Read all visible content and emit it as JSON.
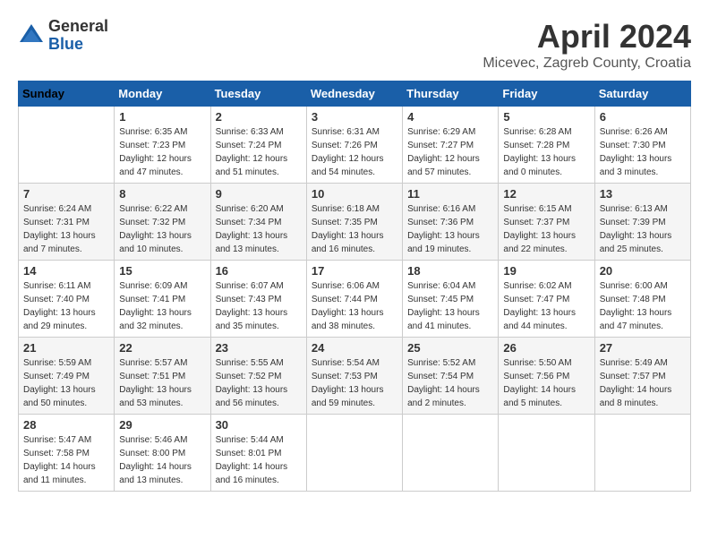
{
  "header": {
    "logo_general": "General",
    "logo_blue": "Blue",
    "month": "April 2024",
    "location": "Micevec, Zagreb County, Croatia"
  },
  "days_of_week": [
    "Sunday",
    "Monday",
    "Tuesday",
    "Wednesday",
    "Thursday",
    "Friday",
    "Saturday"
  ],
  "weeks": [
    [
      {
        "day": "",
        "sunrise": "",
        "sunset": "",
        "daylight": ""
      },
      {
        "day": "1",
        "sunrise": "Sunrise: 6:35 AM",
        "sunset": "Sunset: 7:23 PM",
        "daylight": "Daylight: 12 hours and 47 minutes."
      },
      {
        "day": "2",
        "sunrise": "Sunrise: 6:33 AM",
        "sunset": "Sunset: 7:24 PM",
        "daylight": "Daylight: 12 hours and 51 minutes."
      },
      {
        "day": "3",
        "sunrise": "Sunrise: 6:31 AM",
        "sunset": "Sunset: 7:26 PM",
        "daylight": "Daylight: 12 hours and 54 minutes."
      },
      {
        "day": "4",
        "sunrise": "Sunrise: 6:29 AM",
        "sunset": "Sunset: 7:27 PM",
        "daylight": "Daylight: 12 hours and 57 minutes."
      },
      {
        "day": "5",
        "sunrise": "Sunrise: 6:28 AM",
        "sunset": "Sunset: 7:28 PM",
        "daylight": "Daylight: 13 hours and 0 minutes."
      },
      {
        "day": "6",
        "sunrise": "Sunrise: 6:26 AM",
        "sunset": "Sunset: 7:30 PM",
        "daylight": "Daylight: 13 hours and 3 minutes."
      }
    ],
    [
      {
        "day": "7",
        "sunrise": "Sunrise: 6:24 AM",
        "sunset": "Sunset: 7:31 PM",
        "daylight": "Daylight: 13 hours and 7 minutes."
      },
      {
        "day": "8",
        "sunrise": "Sunrise: 6:22 AM",
        "sunset": "Sunset: 7:32 PM",
        "daylight": "Daylight: 13 hours and 10 minutes."
      },
      {
        "day": "9",
        "sunrise": "Sunrise: 6:20 AM",
        "sunset": "Sunset: 7:34 PM",
        "daylight": "Daylight: 13 hours and 13 minutes."
      },
      {
        "day": "10",
        "sunrise": "Sunrise: 6:18 AM",
        "sunset": "Sunset: 7:35 PM",
        "daylight": "Daylight: 13 hours and 16 minutes."
      },
      {
        "day": "11",
        "sunrise": "Sunrise: 6:16 AM",
        "sunset": "Sunset: 7:36 PM",
        "daylight": "Daylight: 13 hours and 19 minutes."
      },
      {
        "day": "12",
        "sunrise": "Sunrise: 6:15 AM",
        "sunset": "Sunset: 7:37 PM",
        "daylight": "Daylight: 13 hours and 22 minutes."
      },
      {
        "day": "13",
        "sunrise": "Sunrise: 6:13 AM",
        "sunset": "Sunset: 7:39 PM",
        "daylight": "Daylight: 13 hours and 25 minutes."
      }
    ],
    [
      {
        "day": "14",
        "sunrise": "Sunrise: 6:11 AM",
        "sunset": "Sunset: 7:40 PM",
        "daylight": "Daylight: 13 hours and 29 minutes."
      },
      {
        "day": "15",
        "sunrise": "Sunrise: 6:09 AM",
        "sunset": "Sunset: 7:41 PM",
        "daylight": "Daylight: 13 hours and 32 minutes."
      },
      {
        "day": "16",
        "sunrise": "Sunrise: 6:07 AM",
        "sunset": "Sunset: 7:43 PM",
        "daylight": "Daylight: 13 hours and 35 minutes."
      },
      {
        "day": "17",
        "sunrise": "Sunrise: 6:06 AM",
        "sunset": "Sunset: 7:44 PM",
        "daylight": "Daylight: 13 hours and 38 minutes."
      },
      {
        "day": "18",
        "sunrise": "Sunrise: 6:04 AM",
        "sunset": "Sunset: 7:45 PM",
        "daylight": "Daylight: 13 hours and 41 minutes."
      },
      {
        "day": "19",
        "sunrise": "Sunrise: 6:02 AM",
        "sunset": "Sunset: 7:47 PM",
        "daylight": "Daylight: 13 hours and 44 minutes."
      },
      {
        "day": "20",
        "sunrise": "Sunrise: 6:00 AM",
        "sunset": "Sunset: 7:48 PM",
        "daylight": "Daylight: 13 hours and 47 minutes."
      }
    ],
    [
      {
        "day": "21",
        "sunrise": "Sunrise: 5:59 AM",
        "sunset": "Sunset: 7:49 PM",
        "daylight": "Daylight: 13 hours and 50 minutes."
      },
      {
        "day": "22",
        "sunrise": "Sunrise: 5:57 AM",
        "sunset": "Sunset: 7:51 PM",
        "daylight": "Daylight: 13 hours and 53 minutes."
      },
      {
        "day": "23",
        "sunrise": "Sunrise: 5:55 AM",
        "sunset": "Sunset: 7:52 PM",
        "daylight": "Daylight: 13 hours and 56 minutes."
      },
      {
        "day": "24",
        "sunrise": "Sunrise: 5:54 AM",
        "sunset": "Sunset: 7:53 PM",
        "daylight": "Daylight: 13 hours and 59 minutes."
      },
      {
        "day": "25",
        "sunrise": "Sunrise: 5:52 AM",
        "sunset": "Sunset: 7:54 PM",
        "daylight": "Daylight: 14 hours and 2 minutes."
      },
      {
        "day": "26",
        "sunrise": "Sunrise: 5:50 AM",
        "sunset": "Sunset: 7:56 PM",
        "daylight": "Daylight: 14 hours and 5 minutes."
      },
      {
        "day": "27",
        "sunrise": "Sunrise: 5:49 AM",
        "sunset": "Sunset: 7:57 PM",
        "daylight": "Daylight: 14 hours and 8 minutes."
      }
    ],
    [
      {
        "day": "28",
        "sunrise": "Sunrise: 5:47 AM",
        "sunset": "Sunset: 7:58 PM",
        "daylight": "Daylight: 14 hours and 11 minutes."
      },
      {
        "day": "29",
        "sunrise": "Sunrise: 5:46 AM",
        "sunset": "Sunset: 8:00 PM",
        "daylight": "Daylight: 14 hours and 13 minutes."
      },
      {
        "day": "30",
        "sunrise": "Sunrise: 5:44 AM",
        "sunset": "Sunset: 8:01 PM",
        "daylight": "Daylight: 14 hours and 16 minutes."
      },
      {
        "day": "",
        "sunrise": "",
        "sunset": "",
        "daylight": ""
      },
      {
        "day": "",
        "sunrise": "",
        "sunset": "",
        "daylight": ""
      },
      {
        "day": "",
        "sunrise": "",
        "sunset": "",
        "daylight": ""
      },
      {
        "day": "",
        "sunrise": "",
        "sunset": "",
        "daylight": ""
      }
    ]
  ]
}
